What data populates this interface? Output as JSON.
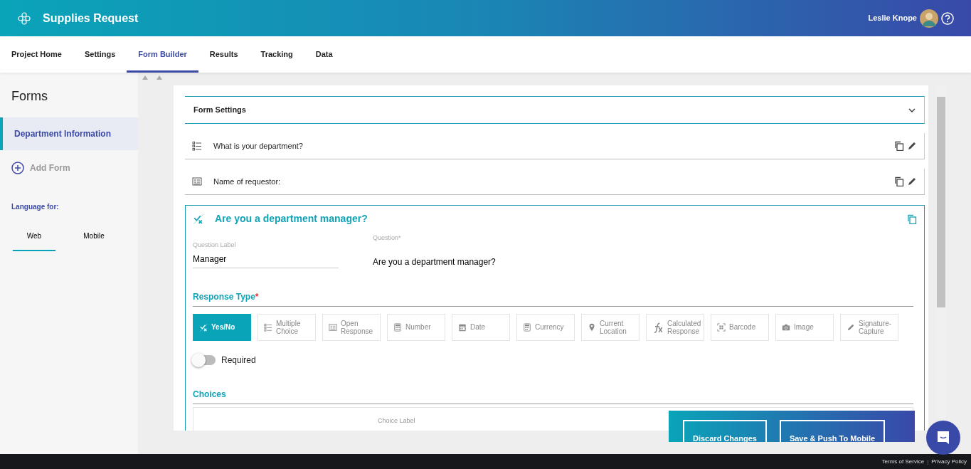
{
  "app": {
    "title": "Supplies Request",
    "user_name": "Leslie Knope"
  },
  "nav_tabs": [
    {
      "label": "Project Home",
      "selected": false
    },
    {
      "label": "Settings",
      "selected": false
    },
    {
      "label": "Form Builder",
      "selected": true
    },
    {
      "label": "Results",
      "selected": false
    },
    {
      "label": "Tracking",
      "selected": false
    },
    {
      "label": "Data",
      "selected": false
    }
  ],
  "sidebar": {
    "title": "Forms",
    "forms": [
      {
        "label": "Department Information",
        "selected": true
      }
    ],
    "add_form": "Add Form",
    "language_label": "Language for:",
    "language_tabs": [
      {
        "label": "Web",
        "selected": true
      },
      {
        "label": "Mobile",
        "selected": false
      }
    ]
  },
  "form_settings": {
    "title": "Form Settings",
    "expanded": false
  },
  "questions": [
    {
      "kind": "multiple",
      "text": "What is your department?",
      "expanded": false
    },
    {
      "kind": "open",
      "text": "Name of requestor:",
      "expanded": false
    },
    {
      "kind": "yesno",
      "text": "Are you a department manager?",
      "expanded": true
    }
  ],
  "editor": {
    "label_field": {
      "label": "Question Label",
      "value": "Manager"
    },
    "question_field": {
      "label": "Question*",
      "value": "Are you a department manager?"
    },
    "response_type_heading": "Response Type",
    "required_marker": "*",
    "response_types": [
      {
        "kind": "yesno",
        "label": "Yes/No",
        "selected": true
      },
      {
        "kind": "multiple",
        "label": "Multiple Choice",
        "selected": false
      },
      {
        "kind": "open",
        "label": "Open Response",
        "selected": false
      },
      {
        "kind": "number",
        "label": "Number",
        "selected": false
      },
      {
        "kind": "date",
        "label": "Date",
        "selected": false
      },
      {
        "kind": "currency",
        "label": "Currency",
        "selected": false
      },
      {
        "kind": "location",
        "label": "Current Location",
        "selected": false
      },
      {
        "kind": "calculated",
        "label": "Calculated Response",
        "selected": false
      },
      {
        "kind": "barcode",
        "label": "Barcode",
        "selected": false
      },
      {
        "kind": "image",
        "label": "Image",
        "selected": false
      },
      {
        "kind": "signature",
        "label": "Signature-Capture",
        "selected": false
      }
    ],
    "required": {
      "label": "Required",
      "on": false
    },
    "choices_heading": "Choices",
    "choices_column": "Choice Label"
  },
  "actions": [
    {
      "label": "Discard Changes"
    },
    {
      "label": "Save & Push To Mobile"
    }
  ],
  "footer": {
    "links": [
      "Terms of Service",
      "Privacy Policy"
    ],
    "separator": "|"
  }
}
